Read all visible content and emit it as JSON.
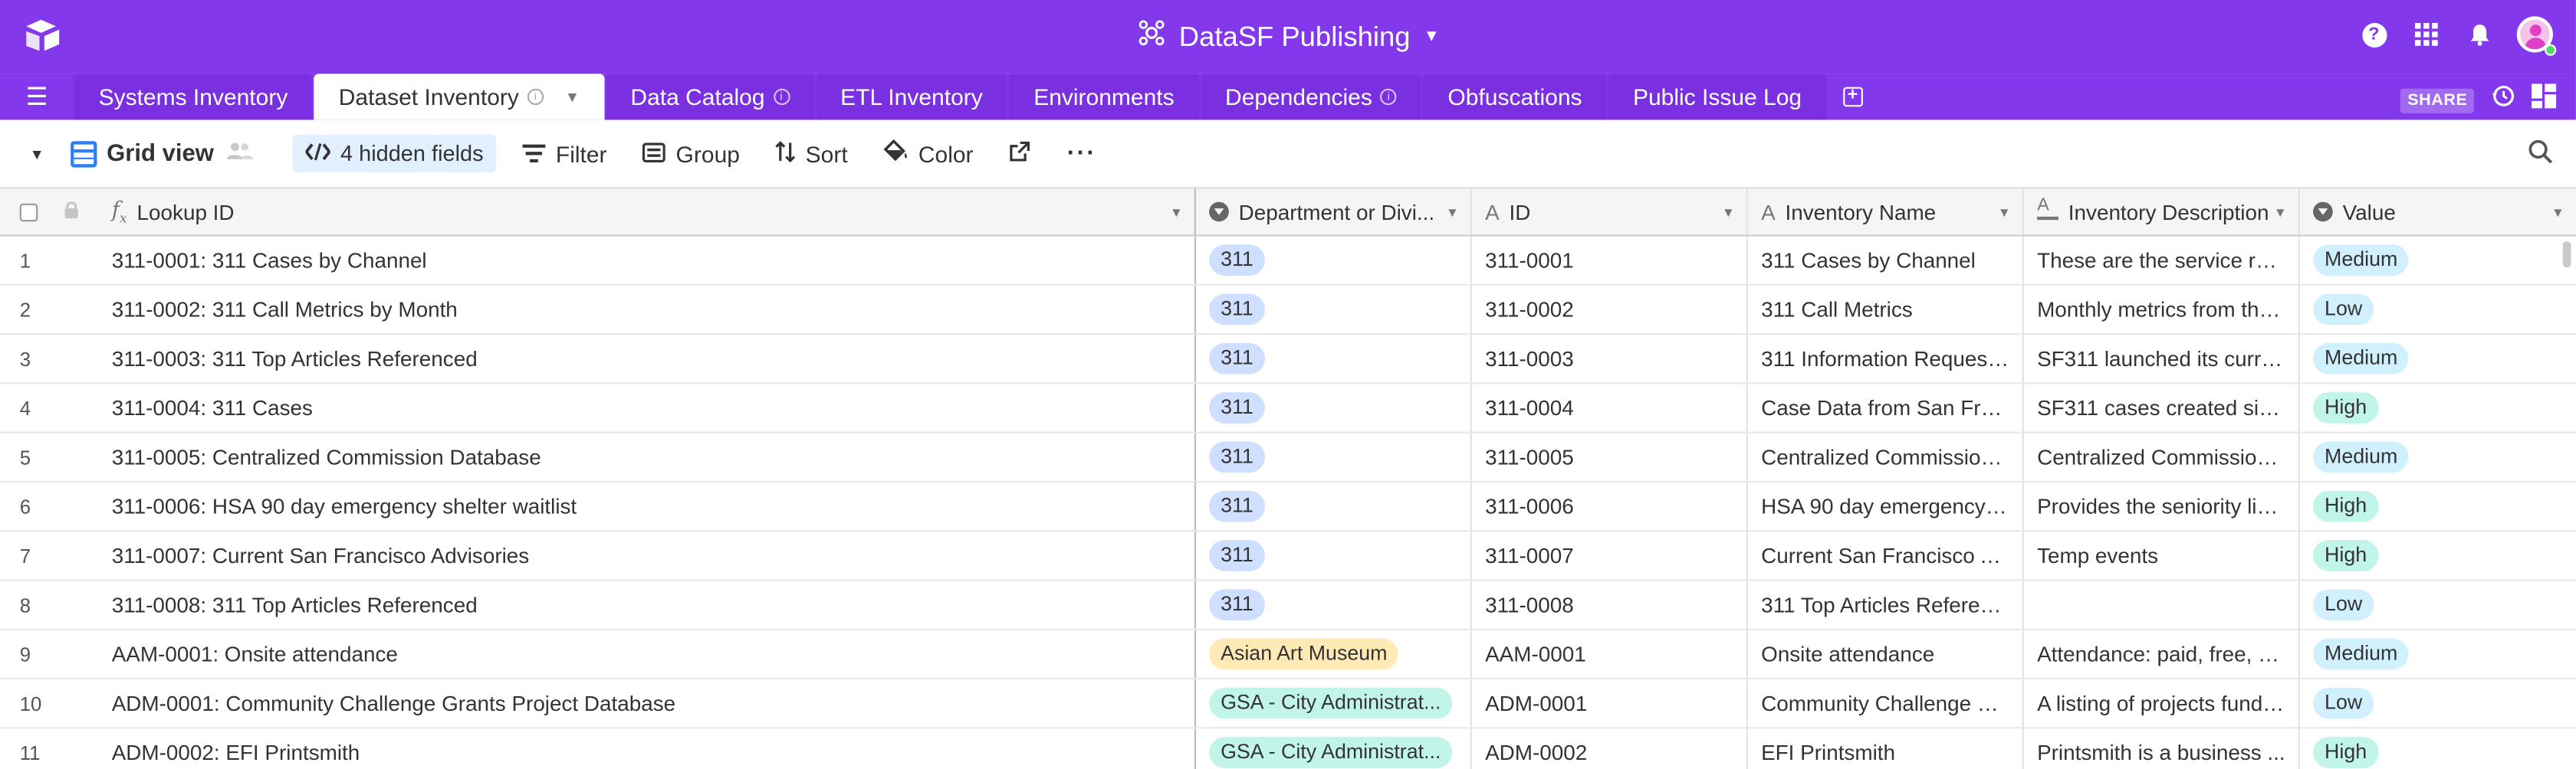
{
  "app": {
    "base_title": "DataSF Publishing",
    "share_label": "SHARE"
  },
  "tabs": [
    {
      "label": "Systems Inventory",
      "active": false,
      "info": false
    },
    {
      "label": "Dataset Inventory",
      "active": true,
      "info": true
    },
    {
      "label": "Data Catalog",
      "active": false,
      "info": true
    },
    {
      "label": "ETL Inventory",
      "active": false,
      "info": false
    },
    {
      "label": "Environments",
      "active": false,
      "info": false
    },
    {
      "label": "Dependencies",
      "active": false,
      "info": true
    },
    {
      "label": "Obfuscations",
      "active": false,
      "info": false
    },
    {
      "label": "Public Issue Log",
      "active": false,
      "info": false
    }
  ],
  "toolbar": {
    "view_name": "Grid view",
    "hidden_fields": "4 hidden fields",
    "filter": "Filter",
    "group": "Group",
    "sort": "Sort",
    "color": "Color"
  },
  "columns": {
    "lookup": "Lookup ID",
    "dept": "Department or Divi...",
    "id": "ID",
    "name": "Inventory Name",
    "desc": "Inventory Description",
    "value": "Value"
  },
  "colors": {
    "brand_purple": "#8338ec",
    "pill_311": "#cfdfff",
    "pill_asian_art": "#ffeab6",
    "pill_gsa": "#c2f5e9",
    "value_medium": "#d0f0fd",
    "value_low": "#d0f0fd",
    "value_high": "#c2f5e9"
  },
  "rows": [
    {
      "num": "1",
      "lookup": "311-0001: 311 Cases by Channel",
      "dept": "311",
      "dept_color": "#cfdfff",
      "id": "311-0001",
      "name": "311 Cases by Channel",
      "desc": "These are the service req...",
      "value": "Medium",
      "value_color": "#d0f0fd"
    },
    {
      "num": "2",
      "lookup": "311-0002: 311 Call Metrics by Month",
      "dept": "311",
      "dept_color": "#cfdfff",
      "id": "311-0002",
      "name": "311 Call Metrics",
      "desc": "Monthly metrics from the ...",
      "value": "Low",
      "value_color": "#d0f0fd"
    },
    {
      "num": "3",
      "lookup": "311-0003: 311 Top Articles Referenced",
      "dept": "311",
      "dept_color": "#cfdfff",
      "id": "311-0003",
      "name": "311 Information Requests ...",
      "desc": "SF311 launched its curren...",
      "value": "Medium",
      "value_color": "#d0f0fd"
    },
    {
      "num": "4",
      "lookup": "311-0004: 311 Cases",
      "dept": "311",
      "dept_color": "#cfdfff",
      "id": "311-0004",
      "name": "Case Data from San Fran...",
      "desc": "SF311 cases created sinc...",
      "value": "High",
      "value_color": "#c2f5e9"
    },
    {
      "num": "5",
      "lookup": "311-0005: Centralized Commission Database",
      "dept": "311",
      "dept_color": "#cfdfff",
      "id": "311-0005",
      "name": "Centralized Commission ...",
      "desc": "Centralized Commission ...",
      "value": "Medium",
      "value_color": "#d0f0fd"
    },
    {
      "num": "6",
      "lookup": "311-0006: HSA 90 day emergency shelter waitlist",
      "dept": "311",
      "dept_color": "#cfdfff",
      "id": "311-0006",
      "name": "HSA 90 day emergency s...",
      "desc": "Provides the seniority list ...",
      "value": "High",
      "value_color": "#c2f5e9"
    },
    {
      "num": "7",
      "lookup": "311-0007: Current San Francisco Advisories",
      "dept": "311",
      "dept_color": "#cfdfff",
      "id": "311-0007",
      "name": "Current San Francisco Ad...",
      "desc": "Temp events",
      "value": "High",
      "value_color": "#c2f5e9"
    },
    {
      "num": "8",
      "lookup": "311-0008: 311 Top Articles Referenced",
      "dept": "311",
      "dept_color": "#cfdfff",
      "id": "311-0008",
      "name": "311 Top Articles Referenc...",
      "desc": "",
      "value": "Low",
      "value_color": "#d0f0fd"
    },
    {
      "num": "9",
      "lookup": "AAM-0001: Onsite attendance",
      "dept": "Asian Art Museum",
      "dept_color": "#ffeab6",
      "id": "AAM-0001",
      "name": "Onsite attendance",
      "desc": "Attendance: paid, free, vi...",
      "value": "Medium",
      "value_color": "#d0f0fd"
    },
    {
      "num": "10",
      "lookup": "ADM-0001: Community Challenge Grants Project Database",
      "dept": "GSA - City Administrat...",
      "dept_color": "#c2f5e9",
      "id": "ADM-0001",
      "name": "Community Challenge Gr...",
      "desc": "A listing of projects funde...",
      "value": "Low",
      "value_color": "#d0f0fd"
    },
    {
      "num": "11",
      "lookup": "ADM-0002: EFI Printsmith",
      "dept": "GSA - City Administrat...",
      "dept_color": "#c2f5e9",
      "id": "ADM-0002",
      "name": "EFI Printsmith",
      "desc": "Printsmith is a business ...",
      "value": "High",
      "value_color": "#c2f5e9"
    }
  ]
}
